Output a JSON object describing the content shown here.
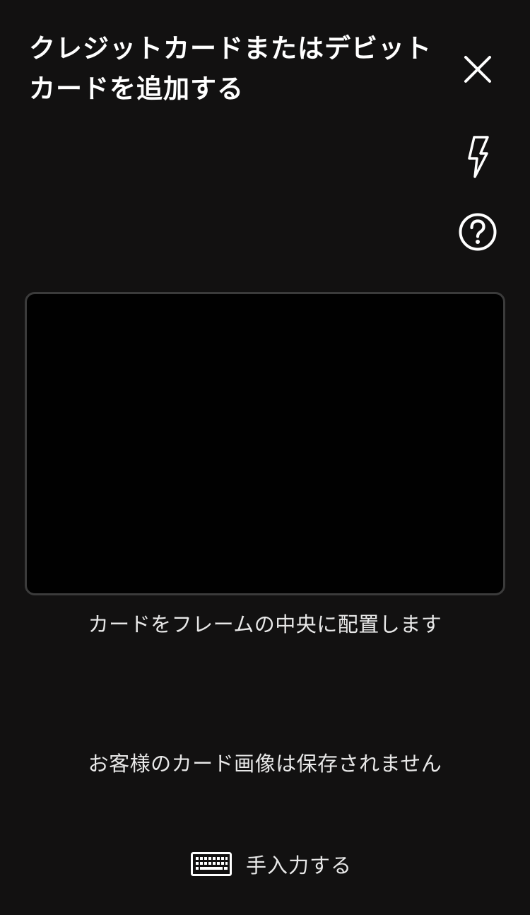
{
  "header": {
    "title": "クレジットカードまたはデビットカードを追加する"
  },
  "controls": {
    "close_icon": "close-icon",
    "flash_icon": "flash-icon",
    "help_icon": "help-icon"
  },
  "scanner": {
    "instruction": "カードをフレームの中央に配置します",
    "privacy_note": "お客様のカード画像は保存されません"
  },
  "manual_entry": {
    "icon": "keyboard-icon",
    "label": "手入力する"
  },
  "colors": {
    "background": "#121111",
    "frame_fill": "#010101",
    "frame_border": "#3b3b3b",
    "text": "#ffffff"
  }
}
